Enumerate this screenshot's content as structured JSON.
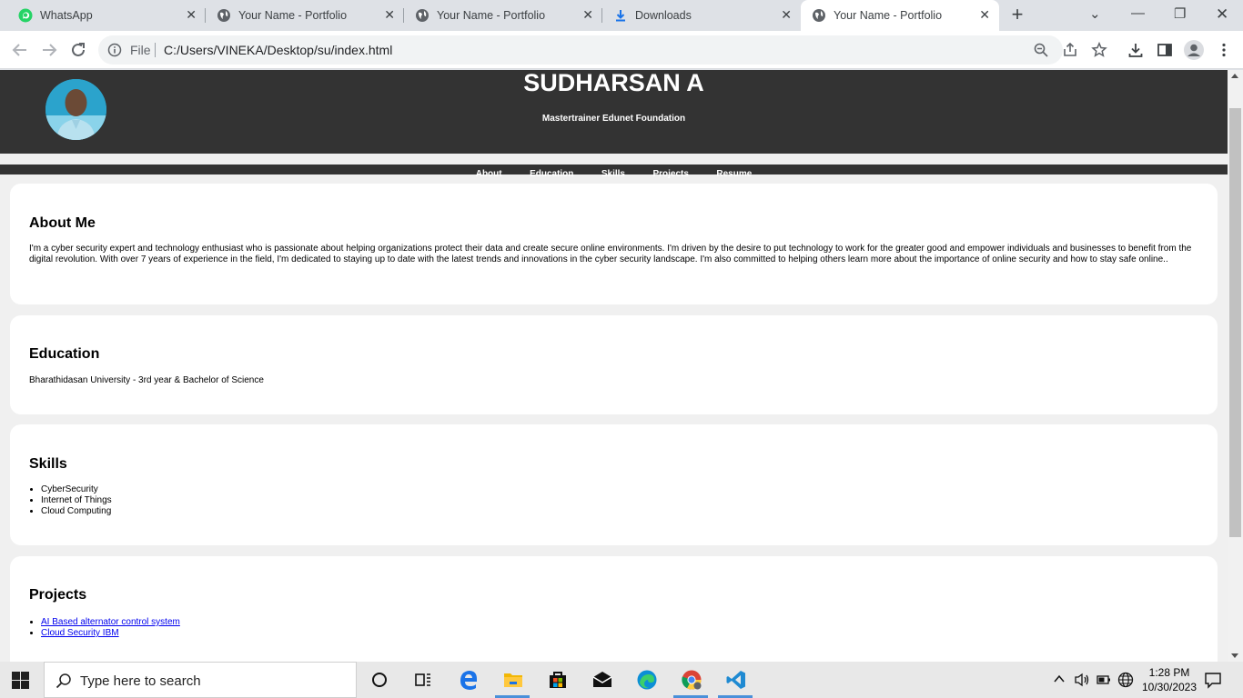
{
  "browser": {
    "tabs": [
      {
        "title": "WhatsApp",
        "icon": "whatsapp-icon"
      },
      {
        "title": "Your Name - Portfolio",
        "icon": "globe-icon"
      },
      {
        "title": "Your Name - Portfolio",
        "icon": "globe-icon"
      },
      {
        "title": "Downloads",
        "icon": "download-icon"
      },
      {
        "title": "Your Name - Portfolio",
        "icon": "globe-icon",
        "active": true
      }
    ],
    "address": {
      "scheme_label": "File",
      "url": "C:/Users/VINEKA/Desktop/su/index.html"
    }
  },
  "page": {
    "name": "SUDHARSAN A",
    "subtitle": "Mastertrainer Edunet Foundation",
    "nav": [
      "About",
      "Education",
      "Skills",
      "Projects",
      "Resume"
    ],
    "about": {
      "heading": "About Me",
      "text": "I'm a cyber security expert and technology enthusiast who is passionate about helping organizations protect their data and create secure online environments. I'm driven by the desire to put technology to work for the greater good and empower individuals and businesses to benefit from the digital revolution. With over 7 years of experience in the field, I'm dedicated to staying up to date with the latest trends and innovations in the cyber security landscape. I'm also committed to helping others learn more about the importance of online security and how to stay safe online.."
    },
    "education": {
      "heading": "Education",
      "text": "Bharathidasan University - 3rd year & Bachelor of Science"
    },
    "skills": {
      "heading": "Skills",
      "items": [
        "CyberSecurity",
        "Internet of Things",
        "Cloud Computing"
      ]
    },
    "projects": {
      "heading": "Projects",
      "items": [
        "AI Based alternator control system",
        "Cloud Security IBM"
      ]
    }
  },
  "taskbar": {
    "search_placeholder": "Type here to search",
    "time": "1:28 PM",
    "date": "10/30/2023"
  },
  "colors": {
    "header_bg": "#333333",
    "page_bg": "#f0f0f0",
    "card_bg": "#ffffff",
    "link": "#0000ee"
  }
}
